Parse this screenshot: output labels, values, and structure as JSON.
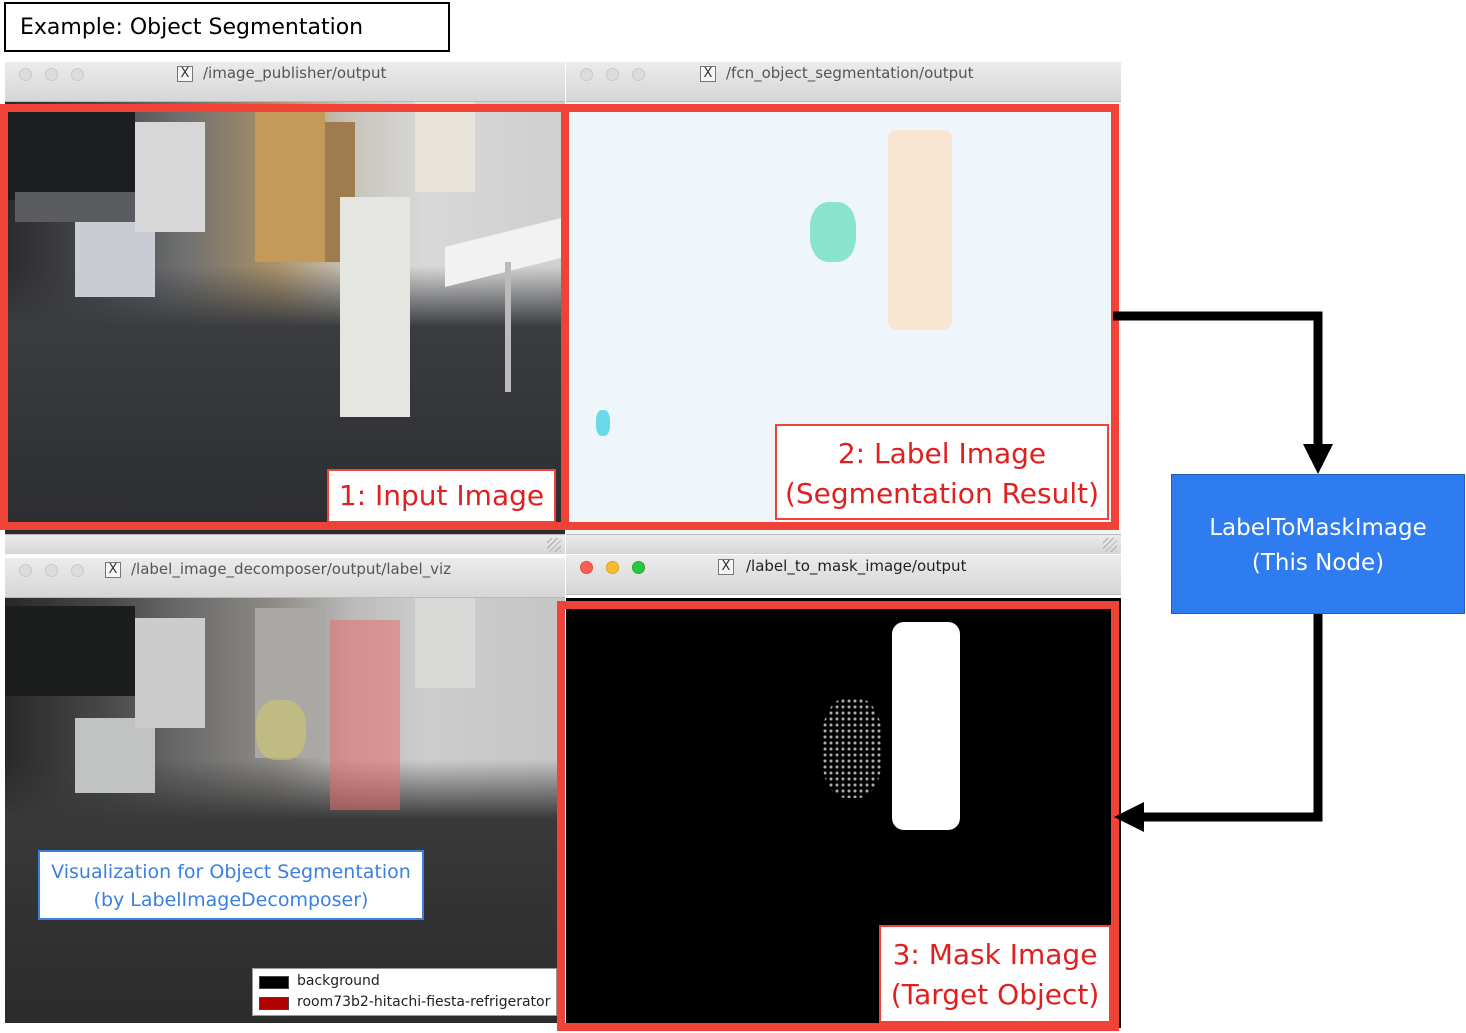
{
  "header": {
    "label": "Example: Object Segmentation"
  },
  "windows": [
    {
      "title": "/image_publisher/output"
    },
    {
      "title": "/fcn_object_segmentation/output"
    },
    {
      "title": "/label_image_decomposer/output/label_viz"
    },
    {
      "title": "/label_to_mask_image/output"
    }
  ],
  "captions": {
    "input": "1: Input Image",
    "label_line1": "2: Label Image",
    "label_line2": "(Segmentation Result)",
    "mask_line1": "3: Mask Image",
    "mask_line2": "(Target Object)",
    "viz_line1": "Visualization for Object Segmentation",
    "viz_line2": "(by LabelImageDecomposer)"
  },
  "node": {
    "line1": "LabelToMaskImage",
    "line2": "(This Node)"
  },
  "legend": {
    "items": [
      {
        "label": "background",
        "color": "#000000"
      },
      {
        "label": "room73b2-hitachi-fiesta-refrigerator",
        "color": "#b00000"
      }
    ]
  },
  "colors": {
    "highlight": "#ef4338",
    "node_fill": "#2f7cf0",
    "viz_caption": "#3b7fe0",
    "arrow": "#000000"
  },
  "icons": [
    "x11-window-icon",
    "traffic-light-close-icon",
    "traffic-light-minimize-icon",
    "traffic-light-zoom-icon",
    "resize-grip-icon"
  ]
}
